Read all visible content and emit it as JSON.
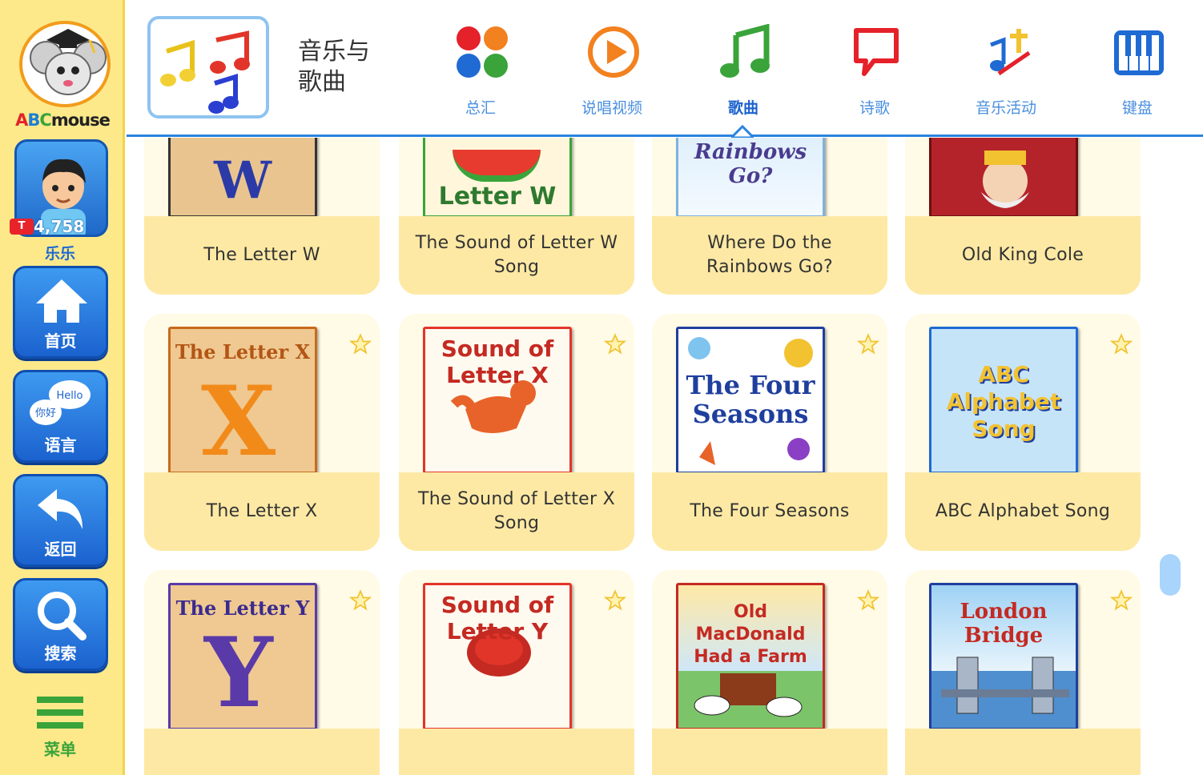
{
  "sidebar": {
    "logo_text": [
      "A",
      "B",
      "C",
      "mouse"
    ],
    "user": {
      "coins": "4,758",
      "badge": "T",
      "label": "乐乐"
    },
    "nav": [
      {
        "label": "首页",
        "icon": "house-icon"
      },
      {
        "label": "语言",
        "icon": "chat-bubbles-icon",
        "bubble1": "Hello",
        "bubble2": "你好"
      },
      {
        "label": "返回",
        "icon": "back-arrow-icon"
      },
      {
        "label": "搜索",
        "icon": "search-icon"
      }
    ],
    "menu_label": "菜单"
  },
  "header": {
    "category_title": "音乐与\n歌曲",
    "tabs": [
      {
        "label": "总汇",
        "icon": "dots-grid-icon"
      },
      {
        "label": "说唱视频",
        "icon": "play-circle-icon"
      },
      {
        "label": "歌曲",
        "icon": "music-note-icon",
        "active": true
      },
      {
        "label": "诗歌",
        "icon": "speech-bubble-icon"
      },
      {
        "label": "音乐活动",
        "icon": "music-pencil-icon"
      },
      {
        "label": "键盘",
        "icon": "keyboard-icon"
      }
    ]
  },
  "cards": [
    {
      "title": "The Letter W",
      "thumb_text": "W"
    },
    {
      "title": "The Sound of Letter W Song",
      "thumb_text": "Letter W"
    },
    {
      "title": "Where Do the Rainbows Go?",
      "thumb_text": "Rainbows Go?"
    },
    {
      "title": "Old King Cole",
      "thumb_text": ""
    },
    {
      "title": "The Letter X",
      "thumb_text": "The Letter X"
    },
    {
      "title": "The Sound of Letter X Song",
      "thumb_text": "Sound of Letter X"
    },
    {
      "title": "The Four Seasons",
      "thumb_text": "The Four Seasons"
    },
    {
      "title": "ABC Alphabet Song",
      "thumb_text": "ABC Alphabet Song"
    },
    {
      "title": "",
      "thumb_text": "The Letter Y"
    },
    {
      "title": "",
      "thumb_text": "Sound of Letter Y"
    },
    {
      "title": "",
      "thumb_text": "Old MacDonald Had a Farm"
    },
    {
      "title": "",
      "thumb_text": "London Bridge"
    }
  ],
  "colors": {
    "sidebar_bg": "#fde98a",
    "accent_blue": "#1b62cf",
    "card_bg": "#fffbe6",
    "caption_bg": "#fde9a4"
  }
}
